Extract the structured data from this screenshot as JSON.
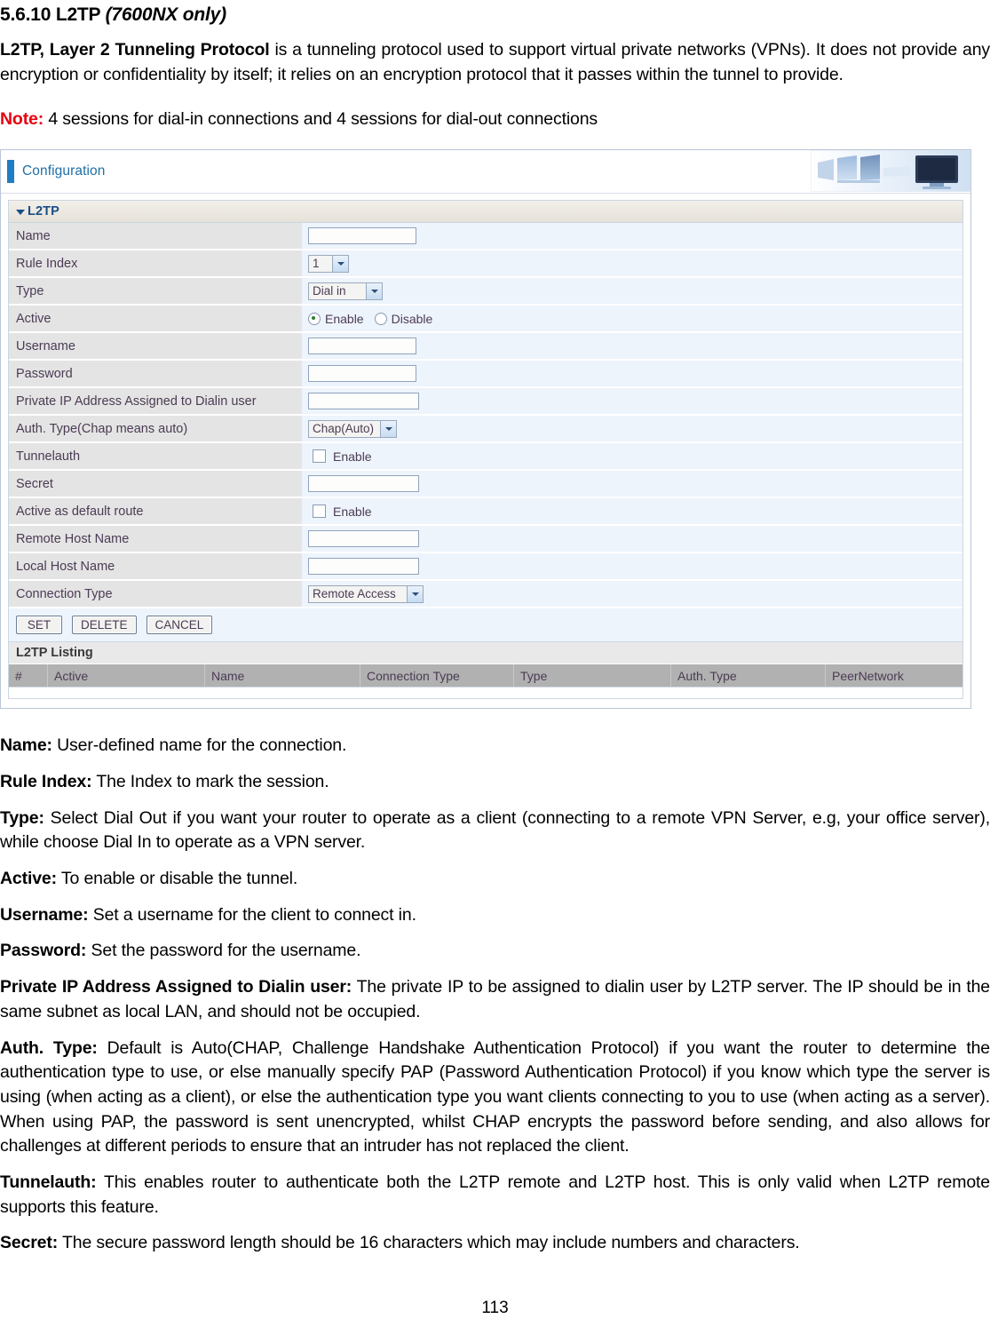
{
  "heading": {
    "number_title": "5.6.10 L2TP ",
    "italic_suffix": "(7600NX only)"
  },
  "intro": {
    "bold_lead": "L2TP, Layer 2 Tunneling Protocol",
    "rest": " is a tunneling protocol used to support virtual private networks (VPNs). It does not provide any encryption or confidentiality by itself; it relies on an encryption protocol that it passes within the tunnel to provide."
  },
  "note": {
    "label": "Note:",
    "text": " 4 sessions for dial-in connections and 4 sessions for dial-out connections"
  },
  "panel": {
    "header_title": "Configuration",
    "section_title": "L2TP",
    "rows": [
      {
        "label": "Name",
        "widget": "text",
        "value": ""
      },
      {
        "label": "Rule Index",
        "widget": "select",
        "value": "1"
      },
      {
        "label": "Type",
        "widget": "select",
        "value": "Dial in"
      },
      {
        "label": "Active",
        "widget": "radio",
        "options": [
          "Enable",
          "Disable"
        ],
        "selected": "Enable"
      },
      {
        "label": "Username",
        "widget": "text",
        "value": ""
      },
      {
        "label": "Password",
        "widget": "text",
        "value": ""
      },
      {
        "label": "Private IP Address Assigned to Dialin user",
        "widget": "text",
        "value": ""
      },
      {
        "label": "Auth. Type(Chap means auto)",
        "widget": "select",
        "value": "Chap(Auto)"
      },
      {
        "label": "Tunnelauth",
        "widget": "checkbox",
        "checkbox_label": "Enable",
        "checked": false
      },
      {
        "label": "Secret",
        "widget": "text",
        "value": ""
      },
      {
        "label": "Active as default route",
        "widget": "checkbox",
        "checkbox_label": "Enable",
        "checked": false
      },
      {
        "label": "Remote Host Name",
        "widget": "text",
        "value": ""
      },
      {
        "label": "Local Host Name",
        "widget": "text",
        "value": ""
      },
      {
        "label": "Connection Type",
        "widget": "select",
        "value": "Remote Access"
      }
    ],
    "buttons": [
      "SET",
      "DELETE",
      "CANCEL"
    ],
    "listing": {
      "title": "L2TP Listing",
      "columns": [
        "#",
        "Active",
        "Name",
        "Connection Type",
        "Type",
        "Auth. Type",
        "PeerNetwork"
      ],
      "rows": []
    }
  },
  "descriptions": [
    {
      "term": "Name:",
      "text": " User-defined name for the connection."
    },
    {
      "term": "Rule Index:",
      "text": " The Index to mark the session."
    },
    {
      "term": "Type:",
      "text": " Select Dial Out if you want your router to operate as a client (connecting to a remote VPN Server, e.g, your office server), while choose Dial In to operate as a VPN server."
    },
    {
      "term": "Active:",
      "text": " To enable or disable the tunnel."
    },
    {
      "term": "Username:",
      "text": " Set a username for the client to connect in."
    },
    {
      "term": "Password:",
      "text": " Set the password for the username."
    },
    {
      "term": "Private IP Address Assigned to Dialin user:",
      "text": " The private IP to be assigned to dialin user by L2TP server. The IP should be in the same subnet as local LAN, and should not be occupied."
    },
    {
      "term": "Auth. Type:",
      "text": " Default is Auto(CHAP, Challenge Handshake Authentication Protocol) if you want the router to determine the authentication type to use, or else manually specify PAP (Password Authentication Protocol) if you know which type the server is using (when acting as a client), or else the authentication type you want clients connecting to you to use (when acting as a server). When using PAP, the password is sent unencrypted, whilst CHAP encrypts the password before sending, and also allows for challenges at different periods to ensure that an intruder has not replaced the client."
    },
    {
      "term": "Tunnelauth:",
      "text": " This enables router to authenticate both the L2TP remote and L2TP host. This is only valid when L2TP remote supports this feature."
    },
    {
      "term": "Secret:",
      "text": " The secure password length should be 16 characters which may include numbers and characters."
    }
  ],
  "page_number": "113",
  "colors": {
    "accent_blue": "#1f7dc4",
    "note_red": "#e8000d",
    "label_cell": "#e4e4e4",
    "value_cell": "#eef4fc",
    "table_header": "#b1b1b1"
  }
}
